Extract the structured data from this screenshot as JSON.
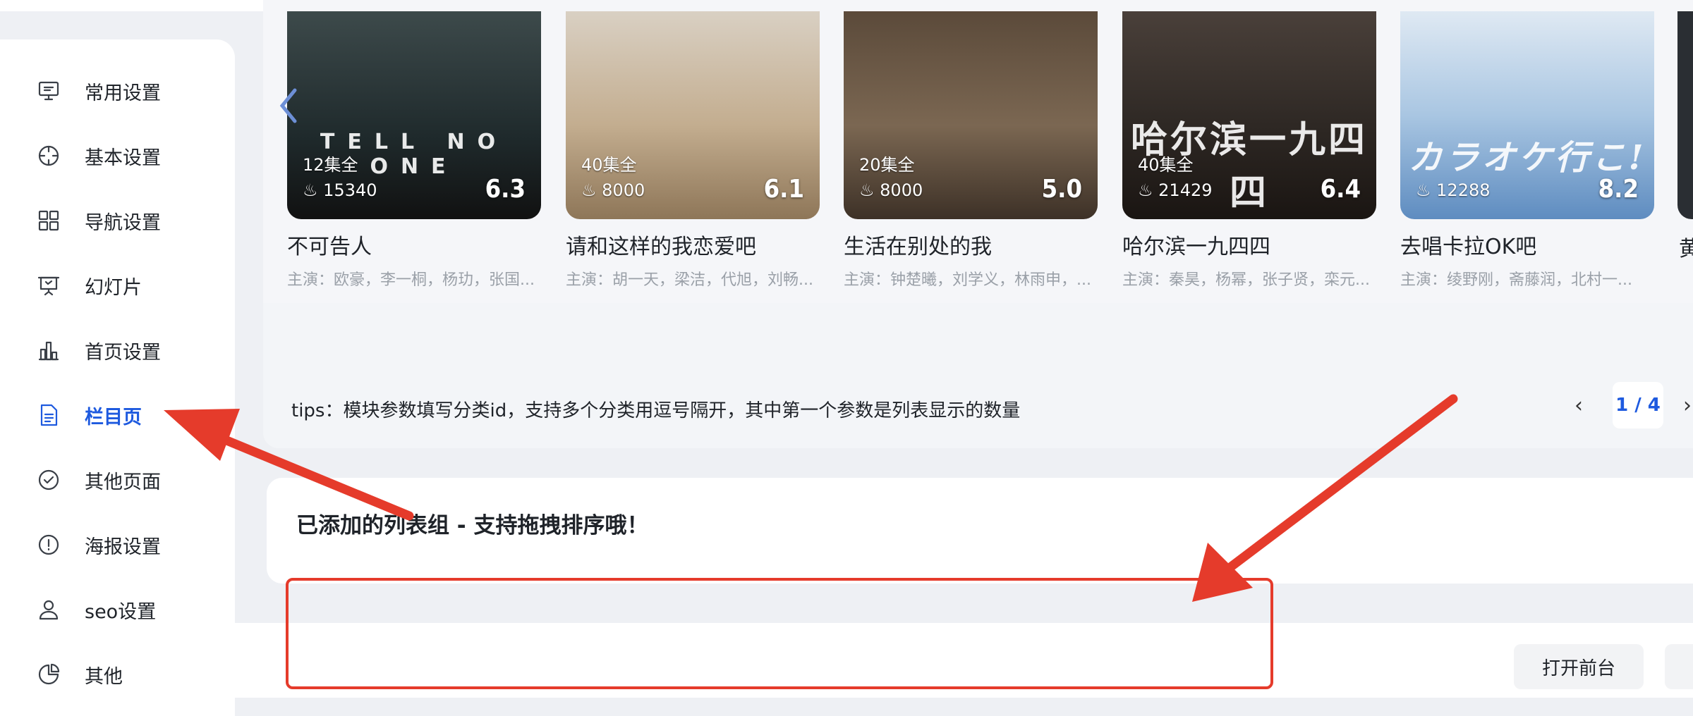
{
  "sidebar": {
    "items": [
      {
        "label": "常用设置",
        "icon": "monitor-settings-icon",
        "active": false
      },
      {
        "label": "基本设置",
        "icon": "crosshair-icon",
        "active": false
      },
      {
        "label": "导航设置",
        "icon": "grid-icon",
        "active": false
      },
      {
        "label": "幻灯片",
        "icon": "presentation-icon",
        "active": false
      },
      {
        "label": "首页设置",
        "icon": "bar-chart-icon",
        "active": false
      },
      {
        "label": "栏目页",
        "icon": "document-icon",
        "active": true
      },
      {
        "label": "其他页面",
        "icon": "check-circle-icon",
        "active": false
      },
      {
        "label": "海报设置",
        "icon": "alert-circle-icon",
        "active": false
      },
      {
        "label": "seo设置",
        "icon": "user-icon",
        "active": false
      },
      {
        "label": "其他",
        "icon": "pie-chart-icon",
        "active": false
      }
    ]
  },
  "gallery": {
    "cards": [
      {
        "title": "不可告人",
        "cast": "主演：欧豪，李一桐，杨玏，张国...",
        "episodes": "12集全",
        "heat": "15340",
        "score": "6.3",
        "poster_text": "TELL NO ONE",
        "color": "#2d3a3c"
      },
      {
        "title": "请和这样的我恋爱吧",
        "cast": "主演：胡一天，梁洁，代旭，刘畅...",
        "episodes": "40集全",
        "heat": "8000",
        "score": "6.1",
        "poster_text": "",
        "color": "#c9b79f"
      },
      {
        "title": "生活在别处的我",
        "cast": "主演：钟楚曦，刘学义，林雨申，...",
        "episodes": "20集全",
        "heat": "8000",
        "score": "5.0",
        "poster_text": "",
        "color": "#6d5947"
      },
      {
        "title": "哈尔滨一九四四",
        "cast": "主演：秦昊，杨幂，张子贤，栾元...",
        "episodes": "40集全",
        "heat": "21429",
        "score": "6.4",
        "poster_text": "哈尔滨一九四四",
        "color": "#3b3330"
      },
      {
        "title": "去唱卡拉OK吧",
        "cast": "主演：绫野刚，斋藤润，北村一...",
        "episodes": "",
        "heat": "12288",
        "score": "8.2",
        "poster_text": "カラオケ行こ!",
        "color": "#8fb4d8"
      }
    ],
    "partial_title": "黄"
  },
  "tips": "tips：模块参数填写分类id，支持多个分类用逗号隔开，其中第一个参数是列表显示的数量",
  "pager": {
    "prev": "‹",
    "current": "1 / 4",
    "next": "›"
  },
  "group": {
    "title": "已添加的列表组 - 支持拖拽排序哦！"
  },
  "footer": {
    "open_label": "打开前台"
  },
  "colors": {
    "accent": "#1e5adf",
    "annotation": "#e53b2b"
  }
}
